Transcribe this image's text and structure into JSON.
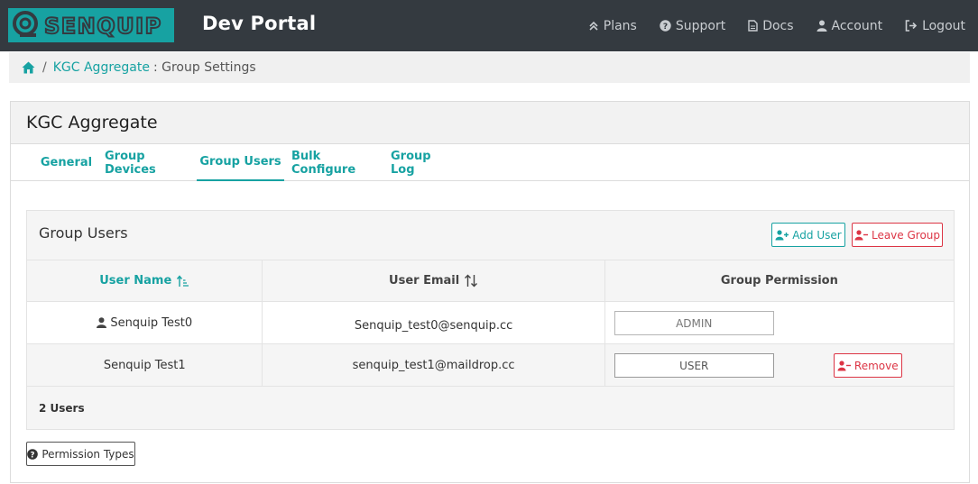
{
  "navbar": {
    "logo_text": "SENQUIP",
    "brand": "Dev Portal",
    "links": [
      {
        "label": "Plans",
        "icon": "chevrons-up-icon"
      },
      {
        "label": "Support",
        "icon": "question-circle-icon"
      },
      {
        "label": "Docs",
        "icon": "document-icon"
      },
      {
        "label": "Account",
        "icon": "user-icon"
      },
      {
        "label": "Logout",
        "icon": "logout-icon"
      }
    ]
  },
  "breadcrumb": {
    "separator": "/",
    "link": "KGC Aggregate",
    "current": ": Group Settings"
  },
  "card": {
    "title": "KGC Aggregate",
    "tabs": [
      {
        "label": "General",
        "active": false
      },
      {
        "label": "Group Devices",
        "active": false
      },
      {
        "label": "Group Users",
        "active": true
      },
      {
        "label": "Bulk Configure",
        "active": false
      },
      {
        "label": "Group Log",
        "active": false
      }
    ]
  },
  "group_users": {
    "title": "Group Users",
    "add_user": "Add User",
    "leave_group": "Leave Group",
    "columns": {
      "name": "User Name",
      "email": "User Email",
      "permission": "Group Permission"
    },
    "rows": [
      {
        "name": "Senquip Test0",
        "email": "Senquip_test0@senquip.cc",
        "permission": "ADMIN",
        "is_current_user": true
      },
      {
        "name": "Senquip Test1",
        "email": "senquip_test1@maildrop.cc",
        "permission": "USER",
        "remove": "Remove"
      }
    ],
    "count": "2 Users"
  },
  "permission_types": "Permission Types",
  "colors": {
    "navbar": "#343a40",
    "teal": "#17a2a2",
    "red": "#dc3545"
  }
}
